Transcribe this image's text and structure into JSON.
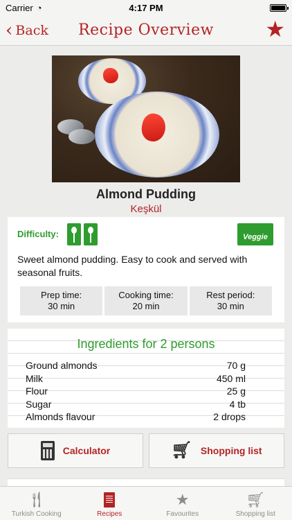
{
  "status_bar": {
    "carrier": "Carrier",
    "time": "4:17 PM"
  },
  "nav": {
    "back_label": "Back",
    "title": "Recipe Overview",
    "favorite_icon": "star-icon"
  },
  "recipe": {
    "name": "Almond Pudding",
    "local_name": "Keşkül",
    "difficulty_label": "Difficulty:",
    "difficulty_level": 2,
    "veggie_label": "Veggie",
    "description": "Sweet almond pudding. Easy to cook and served with seasonal fruits.",
    "times": [
      {
        "label": "Prep time:",
        "value": "30 min"
      },
      {
        "label": "Cooking time:",
        "value": "20 min"
      },
      {
        "label": "Rest period:",
        "value": "30 min"
      }
    ]
  },
  "ingredients": {
    "title": "Ingredients for 2 persons",
    "items": [
      {
        "name": "Ground almonds",
        "amount": "70 g"
      },
      {
        "name": "Milk",
        "amount": "450 ml"
      },
      {
        "name": "Flour",
        "amount": "25 g"
      },
      {
        "name": "Sugar",
        "amount": "4 tb"
      },
      {
        "name": "Almonds flavour",
        "amount": "2 drops"
      }
    ]
  },
  "actions": {
    "calculator": "Calculator",
    "shopping_list": "Shopping list"
  },
  "tabs": [
    {
      "label": "Turkish Cooking",
      "icon": "cutlery-icon"
    },
    {
      "label": "Recipes",
      "icon": "recipe-book-icon"
    },
    {
      "label": "Favourites",
      "icon": "star-icon"
    },
    {
      "label": "Shopping list",
      "icon": "cart-icon"
    }
  ],
  "colors": {
    "accent": "#b32424",
    "green": "#2e9c2e"
  }
}
